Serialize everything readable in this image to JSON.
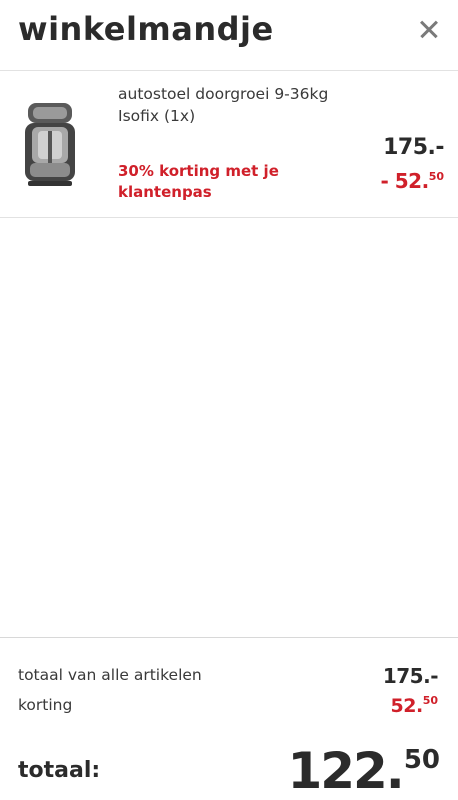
{
  "header": {
    "title": "winkelmandje",
    "close_icon": "close-icon"
  },
  "items": [
    {
      "name": "autostoel doorgroei 9-36kg Isofix (1x)",
      "promo": "30% korting met je klantenpas",
      "price": "175.-",
      "discount_main": "- 52.",
      "discount_cents": "50"
    }
  ],
  "summary": {
    "total_label": "totaal van alle artikelen",
    "total_value": "175.-",
    "discount_label": "korting",
    "discount_main": "52.",
    "discount_cents": "50",
    "grand_label": "totaal:",
    "grand_main": "122.",
    "grand_cents": "50"
  },
  "colors": {
    "accent_red": "#d0202a",
    "text": "#2b2b2b",
    "divider": "#e2e2e2"
  }
}
